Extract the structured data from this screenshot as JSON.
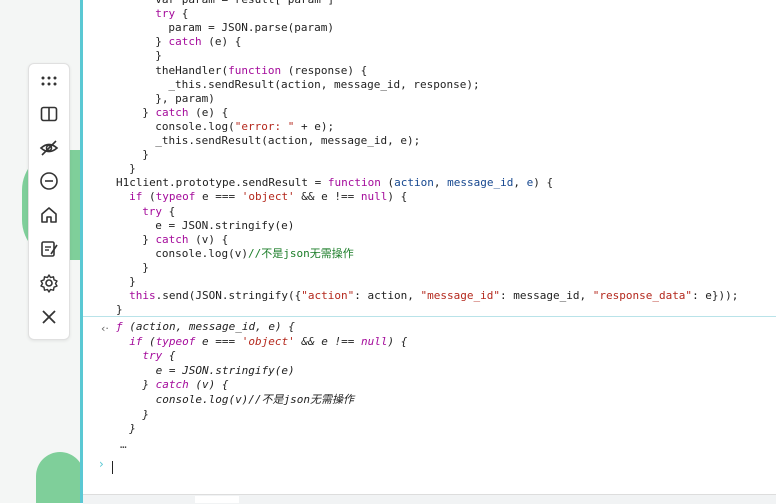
{
  "toolbar": {
    "items": [
      {
        "name": "drag-handle-icon",
        "label": "drag"
      },
      {
        "name": "split-view-icon",
        "label": "split view"
      },
      {
        "name": "hide-icon",
        "label": "hide"
      },
      {
        "name": "minimize-icon",
        "label": "minimize"
      },
      {
        "name": "home-icon",
        "label": "home"
      },
      {
        "name": "edit-note-icon",
        "label": "notes"
      },
      {
        "name": "settings-icon",
        "label": "settings"
      },
      {
        "name": "close-icon",
        "label": "close"
      }
    ]
  },
  "code_lines": [
    {
      "indent": 6,
      "parts": [
        {
          "t": "var param = result[\"param\"]",
          "c": ""
        }
      ]
    },
    {
      "indent": 6,
      "parts": [
        {
          "t": "try",
          "c": "kw"
        },
        {
          "t": " {",
          "c": ""
        }
      ]
    },
    {
      "indent": 8,
      "parts": [
        {
          "t": "param = JSON.parse(param)",
          "c": ""
        }
      ]
    },
    {
      "indent": 6,
      "parts": [
        {
          "t": "} ",
          "c": ""
        },
        {
          "t": "catch",
          "c": "kw"
        },
        {
          "t": " (e) {",
          "c": ""
        }
      ]
    },
    {
      "indent": 6,
      "parts": [
        {
          "t": "}",
          "c": ""
        }
      ]
    },
    {
      "indent": 6,
      "parts": [
        {
          "t": "theHandler(",
          "c": ""
        },
        {
          "t": "function",
          "c": "kw"
        },
        {
          "t": " (response) {",
          "c": ""
        }
      ]
    },
    {
      "indent": 8,
      "parts": [
        {
          "t": "_this.sendResult(action, message_id, response);",
          "c": ""
        }
      ]
    },
    {
      "indent": 6,
      "parts": [
        {
          "t": "}, param)",
          "c": ""
        }
      ]
    },
    {
      "indent": 4,
      "parts": [
        {
          "t": "} ",
          "c": ""
        },
        {
          "t": "catch",
          "c": "kw"
        },
        {
          "t": " (e) {",
          "c": ""
        }
      ]
    },
    {
      "indent": 6,
      "parts": [
        {
          "t": "console.log(",
          "c": ""
        },
        {
          "t": "\"error: \"",
          "c": "str"
        },
        {
          "t": " + e);",
          "c": ""
        }
      ]
    },
    {
      "indent": 6,
      "parts": [
        {
          "t": "_this.sendResult(action, message_id, e);",
          "c": ""
        }
      ]
    },
    {
      "indent": 4,
      "parts": [
        {
          "t": "}",
          "c": ""
        }
      ]
    },
    {
      "indent": 2,
      "parts": [
        {
          "t": "}",
          "c": ""
        }
      ]
    },
    {
      "indent": 0,
      "parts": [
        {
          "t": "H1client.prototype.sendResult = ",
          "c": ""
        },
        {
          "t": "function",
          "c": "kw"
        },
        {
          "t": " (",
          "c": ""
        },
        {
          "t": "action",
          "c": "param"
        },
        {
          "t": ", ",
          "c": ""
        },
        {
          "t": "message_id",
          "c": "param"
        },
        {
          "t": ", ",
          "c": ""
        },
        {
          "t": "e",
          "c": "param"
        },
        {
          "t": ") {",
          "c": ""
        }
      ]
    },
    {
      "indent": 2,
      "parts": [
        {
          "t": "if",
          "c": "kw"
        },
        {
          "t": " (",
          "c": ""
        },
        {
          "t": "typeof",
          "c": "kw"
        },
        {
          "t": " e === ",
          "c": ""
        },
        {
          "t": "'object'",
          "c": "str"
        },
        {
          "t": " && e !== ",
          "c": ""
        },
        {
          "t": "null",
          "c": "kw"
        },
        {
          "t": ") {",
          "c": ""
        }
      ]
    },
    {
      "indent": 4,
      "parts": [
        {
          "t": "try",
          "c": "kw"
        },
        {
          "t": " {",
          "c": ""
        }
      ]
    },
    {
      "indent": 6,
      "parts": [
        {
          "t": "e = JSON.stringify(e)",
          "c": ""
        }
      ]
    },
    {
      "indent": 4,
      "parts": [
        {
          "t": "} ",
          "c": ""
        },
        {
          "t": "catch",
          "c": "kw"
        },
        {
          "t": " (v) {",
          "c": ""
        }
      ]
    },
    {
      "indent": 6,
      "parts": [
        {
          "t": "console.log(v)",
          "c": ""
        },
        {
          "t": "//不是json无需操作",
          "c": "cmt"
        }
      ]
    },
    {
      "indent": 4,
      "parts": [
        {
          "t": "}",
          "c": ""
        }
      ]
    },
    {
      "indent": 2,
      "parts": [
        {
          "t": "}",
          "c": ""
        }
      ]
    },
    {
      "indent": 2,
      "parts": [
        {
          "t": "this",
          "c": "kw"
        },
        {
          "t": ".send(JSON.stringify({",
          "c": ""
        },
        {
          "t": "\"action\"",
          "c": "str"
        },
        {
          "t": ": action, ",
          "c": ""
        },
        {
          "t": "\"message_id\"",
          "c": "str"
        },
        {
          "t": ": message_id, ",
          "c": ""
        },
        {
          "t": "\"response_data\"",
          "c": "str"
        },
        {
          "t": ": e}));",
          "c": ""
        }
      ]
    },
    {
      "indent": 0,
      "parts": [
        {
          "t": "}",
          "c": ""
        }
      ]
    }
  ],
  "result_lines": [
    {
      "indent": 0,
      "parts": [
        {
          "t": "ƒ",
          "c": "kw"
        },
        {
          "t": " (action, message_id, e) {",
          "c": ""
        }
      ]
    },
    {
      "indent": 2,
      "parts": [
        {
          "t": "if",
          "c": "kw"
        },
        {
          "t": " (",
          "c": ""
        },
        {
          "t": "typeof",
          "c": "kw"
        },
        {
          "t": " e === ",
          "c": ""
        },
        {
          "t": "'object'",
          "c": "str"
        },
        {
          "t": " && e !== ",
          "c": ""
        },
        {
          "t": "null",
          "c": "kw"
        },
        {
          "t": ") {",
          "c": ""
        }
      ]
    },
    {
      "indent": 4,
      "parts": [
        {
          "t": "try",
          "c": "kw"
        },
        {
          "t": " {",
          "c": ""
        }
      ]
    },
    {
      "indent": 6,
      "parts": [
        {
          "t": "e = JSON.stringify(e)",
          "c": ""
        }
      ]
    },
    {
      "indent": 4,
      "parts": [
        {
          "t": "} ",
          "c": ""
        },
        {
          "t": "catch",
          "c": "kw"
        },
        {
          "t": " (v) {",
          "c": ""
        }
      ]
    },
    {
      "indent": 6,
      "parts": [
        {
          "t": "console.log(v)//不是json无需操作",
          "c": ""
        }
      ]
    },
    {
      "indent": 4,
      "parts": [
        {
          "t": "}",
          "c": ""
        }
      ]
    },
    {
      "indent": 2,
      "parts": [
        {
          "t": "}",
          "c": ""
        }
      ]
    }
  ],
  "result_ellipsis": "…",
  "expand_arrow": "‹·",
  "prompt_glyph": "›",
  "colors": {
    "accent": "#5ac8d3",
    "blob": "#7fcf9a",
    "keyword": "#a40b9b",
    "string": "#b4281d",
    "comment": "#1b7d28"
  }
}
